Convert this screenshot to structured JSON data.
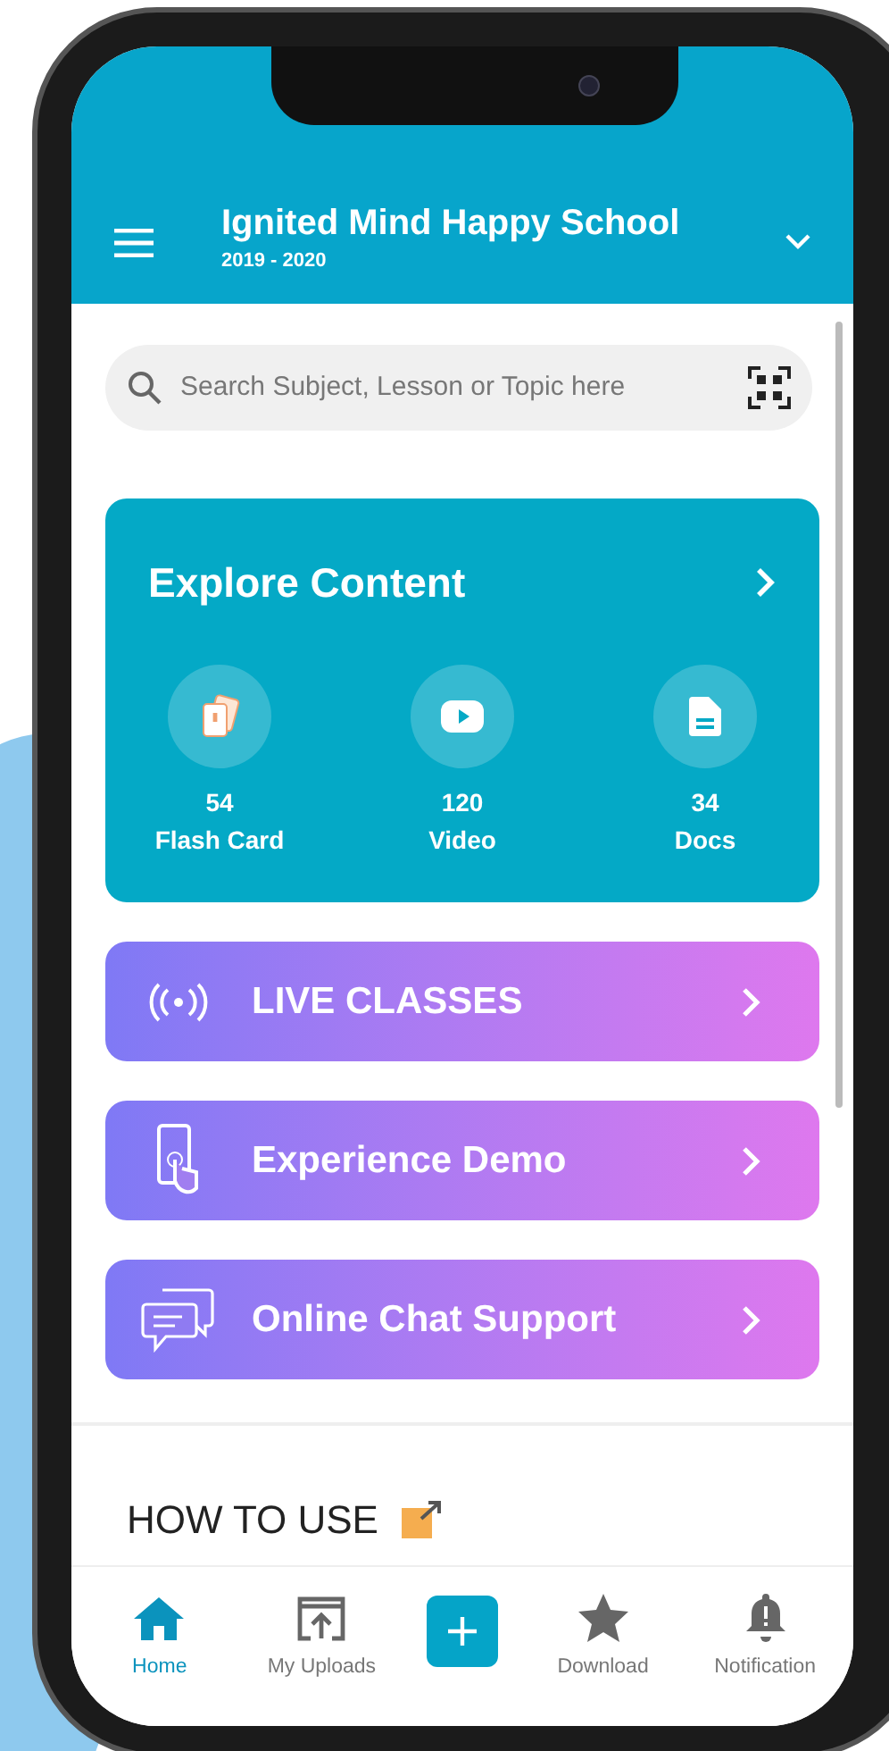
{
  "header": {
    "title": "Ignited Mind Happy School",
    "subtitle": "2019 - 2020"
  },
  "search": {
    "placeholder": "Search Subject, Lesson or Topic here"
  },
  "explore": {
    "title": "Explore Content",
    "items": [
      {
        "kind": "flashcard",
        "count": "54",
        "label": "Flash Card"
      },
      {
        "kind": "video",
        "count": "120",
        "label": "Video"
      },
      {
        "kind": "docs",
        "count": "34",
        "label": "Docs"
      }
    ]
  },
  "actions": [
    {
      "kind": "live",
      "label": "LIVE CLASSES"
    },
    {
      "kind": "demo",
      "label": "Experience Demo"
    },
    {
      "kind": "chat",
      "label": "Online Chat Support"
    }
  ],
  "section_title": "HOW TO USE",
  "nav": [
    {
      "kind": "home",
      "label": "Home",
      "selected": true
    },
    {
      "kind": "uploads",
      "label": "My Uploads",
      "selected": false
    },
    {
      "kind": "add",
      "selected": false
    },
    {
      "kind": "download",
      "label": "Download",
      "selected": false
    },
    {
      "kind": "notification",
      "label": "Notification",
      "selected": false
    }
  ]
}
